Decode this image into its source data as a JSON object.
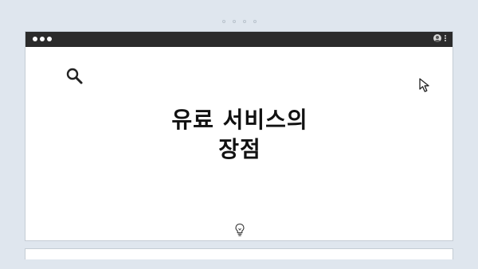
{
  "page": {
    "title_line1": "유료 서비스의",
    "title_line2": "장점"
  },
  "icons": {
    "search": "search-icon",
    "cursor": "cursor-arrow-icon",
    "bulb": "lightbulb-icon",
    "profile": "profile-icon",
    "menu": "more-vert-icon"
  },
  "colors": {
    "background": "#dfe6ee",
    "titlebar": "#2b2b2b",
    "content": "#ffffff",
    "text": "#111111"
  }
}
